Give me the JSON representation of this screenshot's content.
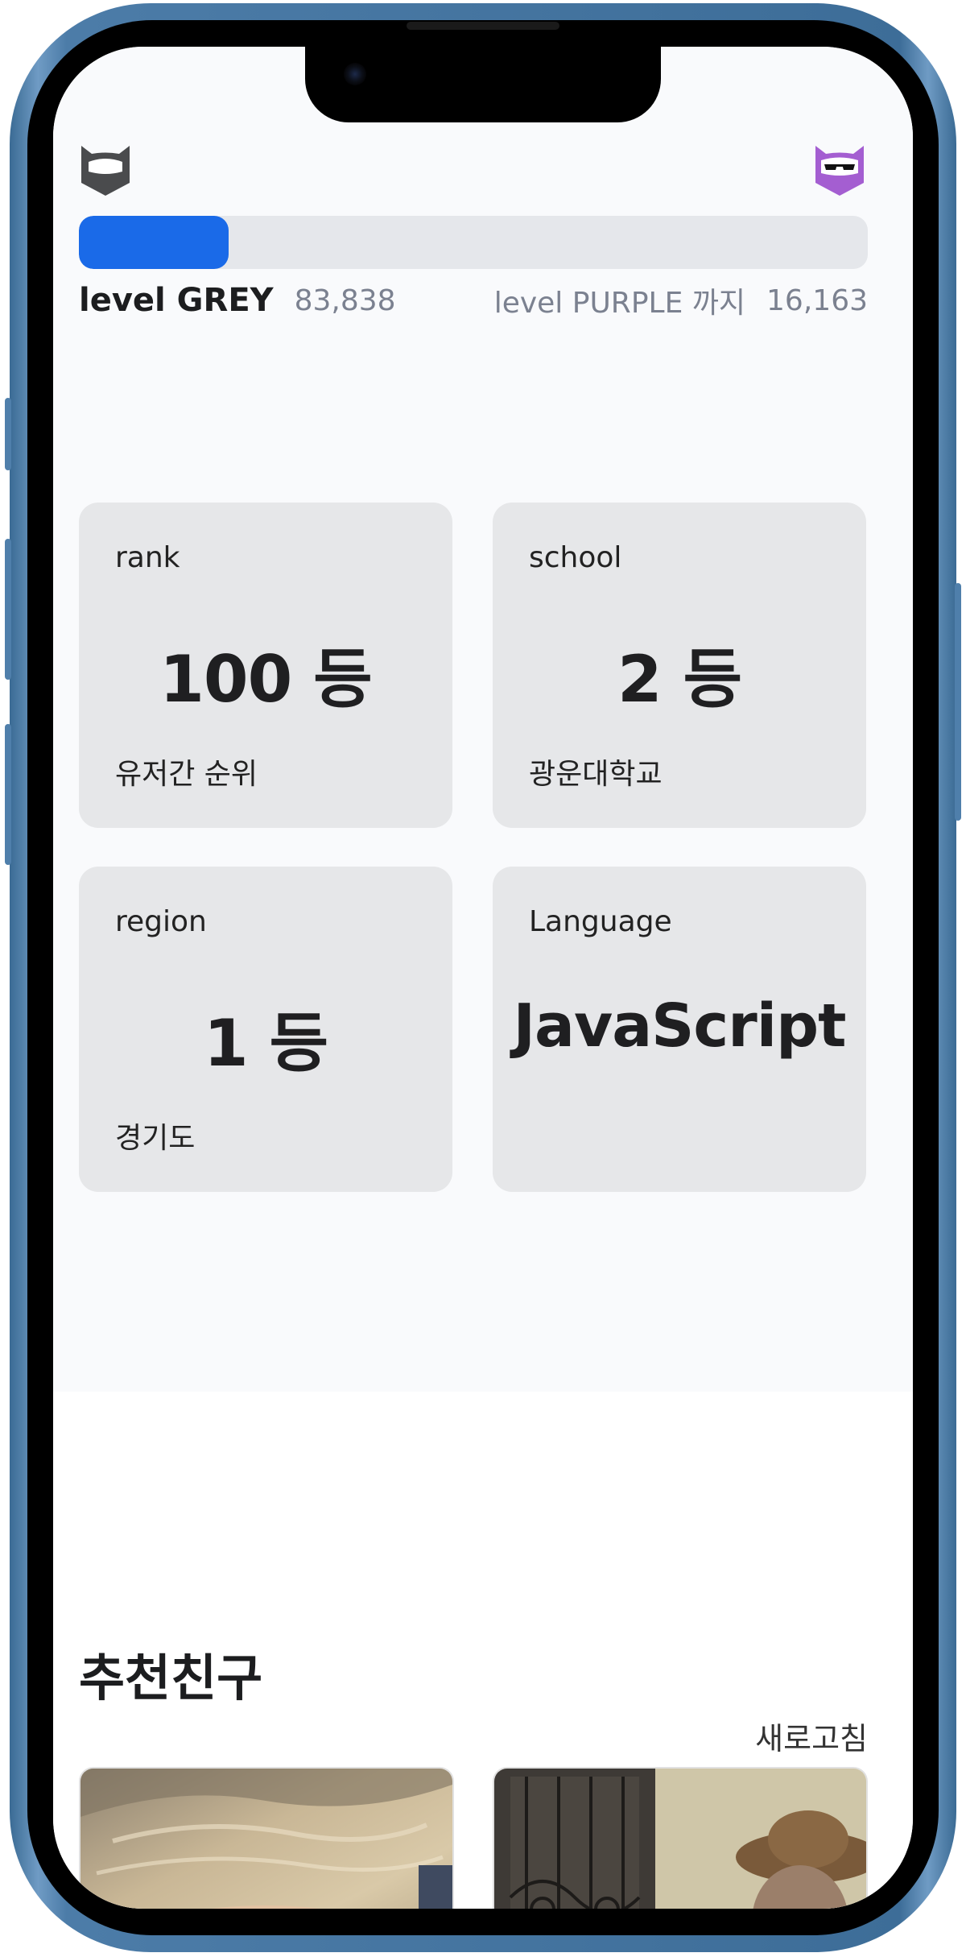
{
  "header": {
    "current_tier_icon": "grey-cat-shield-icon",
    "next_tier_icon": "purple-cat-shield-icon",
    "progress_fraction": 0.19,
    "current_level": "level GREY",
    "current_points": "83,838",
    "next_level_label": "level PURPLE 까지",
    "points_remaining": "16,163",
    "colors": {
      "progress": "#1a6ae8",
      "track": "#e5e7eb",
      "grey_tier": "#4a4b4d",
      "purple_tier": "#a45ed1"
    }
  },
  "stats": [
    {
      "label": "rank",
      "value": "100 등",
      "sub": "유저간 순위"
    },
    {
      "label": "school",
      "value": "2 등",
      "sub": "광운대학교"
    },
    {
      "label": "region",
      "value": "1 등",
      "sub": "경기도"
    },
    {
      "label": "Language",
      "value": "JavaScript",
      "sub": ""
    }
  ],
  "friends": {
    "title": "추천친구",
    "refresh_label": "새로고침",
    "cards": [
      {
        "photo": "blonde-person-photo"
      },
      {
        "photo": "cowboy-hat-person-photo"
      }
    ]
  }
}
